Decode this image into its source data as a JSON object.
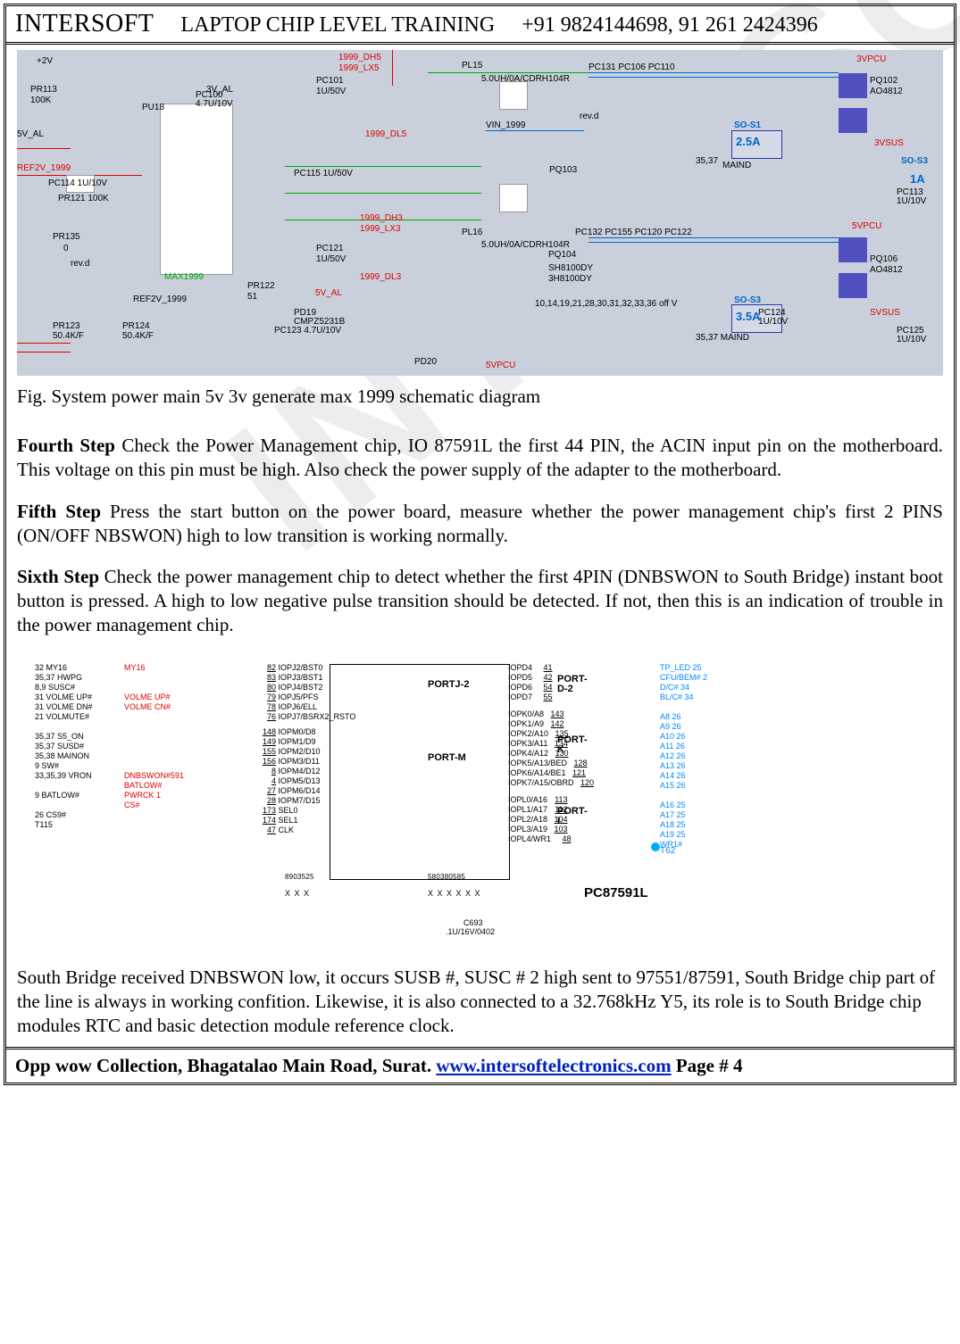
{
  "header": {
    "brand": "INTERSOFT",
    "title": "LAPTOP  CHIP LEVEL TRAINING",
    "phones": "+91 9824144698,  91 261 2424396"
  },
  "watermark": "INTERSOFT",
  "caption": "Fig. System power main 5v 3v generate max 1999 schematic diagram",
  "steps": {
    "fourth": {
      "label": "Fourth Step",
      "text": " Check the Power Management chip, IO 87591L  the first 44 PIN, the ACIN input pin on the motherboard. This voltage on this pin must be high. Also check the power supply of the adapter to the motherboard."
    },
    "fifth": {
      "label": "Fifth Step",
      "text": " Press the start button on the power board, measure whether the power management chip's first 2 PINS (ON/OFF NBSWON) high to low transition is working normally."
    },
    "sixth": {
      "label": "Sixth Step",
      "text": " Check the power management chip to detect whether the first 4PIN (DNBSWON to South Bridge) instant boot button is pressed. A high to low negative pulse transition should be detected. If not, then this is an indication of trouble in the power management chip."
    }
  },
  "south_bridge_text": "South Bridge received DNBSWON low, it occurs SUSB #, SUSC # 2 high sent to 97551/87591, South Bridge chip part of the line is always in working confition. Likewise, it is also connected to a 32.768kHz Y5, its role is to South Bridge chip modules RTC and basic detection module reference clock.",
  "footer": {
    "addr": "Opp wow Collection, Bhagatalao Main Road, Surat.  ",
    "link": "www.intersoftelectronics.com",
    "page": "   Page # 4"
  },
  "schematic1": {
    "labels": {
      "a": "1999_DH5",
      "b": "1999_LX5",
      "c": "PL15",
      "d": "PC131  PC106  PC110",
      "e": "5.0UH/0A/CDRH104R",
      "f": "3VPCU",
      "g": "PQ102",
      "h": "AO4812",
      "i": "PC100",
      "j": "4.7U/10V",
      "k": "5V_AL",
      "l": "PU18",
      "m": "PC101",
      "n": "1U/50V",
      "o": "rev.d",
      "p": "SO-S1",
      "q": "2.5A",
      "r": "VIN_1999",
      "s": "1999_DL5",
      "t": "PC114  1U/10V",
      "u": "PC115 1U/50V",
      "v": "MAIND",
      "w": "PQ103",
      "x": "3VSUS",
      "y": "SO-S3",
      "z": "1A",
      "aa": "PC113",
      "ab": "1U/10V",
      "ac": "PL16",
      "ad": "PC132  PC155 PC120  PC122",
      "ae": "5.0UH/0A/CDRH104R",
      "af": "5VPCU",
      "ag": "MAX1999",
      "ah": "1999_DH3",
      "ai": "1999_LX3",
      "aj": "PC121",
      "ak": "1U/50V",
      "al": "PQ104",
      "am": "SH8100DY",
      "an": "3H8100DY",
      "ao": "PQ106",
      "ap": "AO4812",
      "aq": "PR122",
      "ar": "51",
      "as": "PD19",
      "at": "CMPZ5231B",
      "au": "REF2V_1999",
      "av": "PR121  100K",
      "aw": "5V_AL",
      "ax": "PC123  4.7U/10V",
      "ay": "PD20",
      "az": "5VPCU",
      "ba": "PR123",
      "bb": "50.4K/F",
      "bc": "PR124",
      "bd": "50.4K/F",
      "be": "3VPCU",
      "bf": "1999_DL3",
      "bg": "35,37",
      "bh": "10,14,19,21,28,30,31,32,33,36  off V",
      "bi": "PC124",
      "bj": "1U/10V",
      "bk": "SO-S3",
      "bl": "3.5A",
      "bm": "35,37  MAIND",
      "bn": "PC125",
      "bo": "1U/10V",
      "bp": "SVSUS",
      "bq": "PR113",
      "br": "100K",
      "bs": "PR135",
      "bt": "0",
      "bu": "rev.d",
      "bv": "REF2V_1999",
      "bw": "+2V",
      "bx": "3V_AL"
    }
  },
  "schematic2": {
    "chip_name": "PC87591L",
    "ports": {
      "j2": "PORTJ-2",
      "m": "PORT-M",
      "k": "PORT-K",
      "l": "PORT-L",
      "d2": "PORT-D-2"
    },
    "left_far": [
      "32        MY16",
      "35,37   HWPG",
      "8,9     SUSC#",
      "31  VOLME UP#",
      "31  VOLME DN#",
      "21    VOLMUTE#",
      "",
      "35,37    S5_ON",
      "35,37    SUSD#",
      "35,38    MAINON",
      "9          SW#",
      "33,35,39  VRON",
      "",
      "9      BATLOW#",
      "",
      "26        CS9#",
      "         T115"
    ],
    "left_pins": [
      {
        "n": "82",
        "t": "IOPJ2/BST0"
      },
      {
        "n": "83",
        "t": "IOPJ3/BST1"
      },
      {
        "n": "80",
        "t": "IOPJ4/BST2"
      },
      {
        "n": "79",
        "t": "IOPJ5/PFS"
      },
      {
        "n": "78",
        "t": "IOPJ6/ELL"
      },
      {
        "n": "76",
        "t": "IOPJ7/BSRX2_RSTO"
      },
      {
        "n": "148",
        "t": "IOPM0/D8"
      },
      {
        "n": "149",
        "t": "IOPM1/D9"
      },
      {
        "n": "155",
        "t": "IOPM2/D10"
      },
      {
        "n": "156",
        "t": "IOPM3/D11"
      },
      {
        "n": "8",
        "t": "IOPM4/D12"
      },
      {
        "n": "4",
        "t": "IOPM5/D13"
      },
      {
        "n": "27",
        "t": "IOPM6/D14"
      },
      {
        "n": "28",
        "t": "IOPM7/D15"
      },
      {
        "n": "173",
        "t": "SEL0"
      },
      {
        "n": "174",
        "t": "SEL1"
      },
      {
        "n": "47",
        "t": "CLK"
      }
    ],
    "right_pins": [
      {
        "n": "41",
        "t": "IOPD4"
      },
      {
        "n": "42",
        "t": "IOPD5"
      },
      {
        "n": "54",
        "t": "IOPD6"
      },
      {
        "n": "55",
        "t": "IOPD7"
      },
      {
        "n": "143",
        "t": "IOPK0/A8"
      },
      {
        "n": "142",
        "t": "IOPK1/A9"
      },
      {
        "n": "135",
        "t": "IOPK2/A10"
      },
      {
        "n": "134",
        "t": "IOPK3/A11"
      },
      {
        "n": "130",
        "t": "IOPK4/A12"
      },
      {
        "n": "128",
        "t": "IOPK5/A13/BED"
      },
      {
        "n": "121",
        "t": "IOPK6/A14/BE1"
      },
      {
        "n": "120",
        "t": "IOPK7/A15/OBRD"
      },
      {
        "n": "113",
        "t": "IOPL0/A16"
      },
      {
        "n": "112",
        "t": "IOPL1/A17"
      },
      {
        "n": "104",
        "t": "IOPL2/A18"
      },
      {
        "n": "103",
        "t": "IOPL3/A19"
      },
      {
        "n": "48",
        "t": "IOPL4/WR1"
      }
    ],
    "right_far": [
      "TP_LED  25",
      "CFU/BEM#  2",
      "D/C#  34",
      "BL/C#  34",
      "",
      "A8   26",
      "A9   26",
      "A10  26",
      "A11  26",
      "A12  26",
      "A13  26",
      "A14  26",
      "A15  26",
      "",
      "A16  25",
      "A17  25",
      "A18  25",
      "A19  25",
      "WR1#"
    ],
    "bus_sigs_left": [
      "MY16",
      "",
      "",
      "VOLME UP#",
      "VOLME CN#",
      "",
      "",
      "",
      "",
      "",
      "",
      "DNBSWON#591",
      "BATLOW#",
      "PWRCK 1",
      "CS#"
    ],
    "bottom": {
      "cap": "C693",
      "capv": ".1U/16V/0402",
      "t62": "T62"
    }
  }
}
